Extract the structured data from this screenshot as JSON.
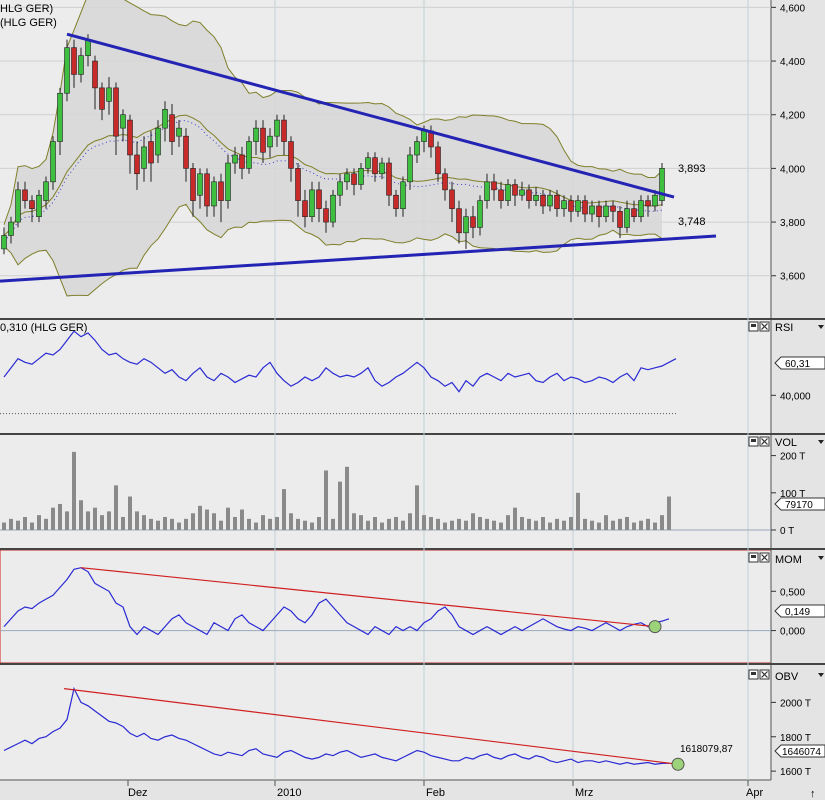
{
  "colors": {
    "panel_bg": "#ececec",
    "grid": "#c8c8c8",
    "band_fill": "#d7d7d7",
    "band_line": "#7f7f2a",
    "trend_blue": "#2424b4",
    "series_blue": "#2a2ad4",
    "up_candle": "#3fbf3f",
    "down_candle": "#c82a2a",
    "volume_bar": "#8a8a8a",
    "red_line": "#d02020",
    "marker_green": "#9cd27a"
  },
  "price_panel": {
    "title_line1": "HLG GER)",
    "title_line2": "(HLG GER)",
    "axis_ticks": [
      "4,600",
      "4,400",
      "4,200",
      "4,000",
      "3,800",
      "3,600"
    ],
    "label_upper": "3,893",
    "label_lower": "3,748"
  },
  "rsi_panel": {
    "title": "0,310 (HLG GER)",
    "name": "RSI",
    "current_value": "60,31",
    "tick": "40,000"
  },
  "vol_panel": {
    "name": "VOL",
    "ticks": [
      "200 T",
      "100 T",
      "0 T"
    ],
    "current_value": "79170"
  },
  "mom_panel": {
    "name": "MOM",
    "ticks": [
      "0,500",
      "0,000"
    ],
    "current_value": "0,149"
  },
  "obv_panel": {
    "name": "OBV",
    "ticks": [
      "2000 T",
      "1800 T",
      "1600 T"
    ],
    "current_value": "1646074",
    "end_label": "1618079,87"
  },
  "x_axis": {
    "labels": [
      "Dez",
      "2010",
      "Feb",
      "Mrz",
      "Apr"
    ],
    "arrow": "↑"
  },
  "chart_data": [
    {
      "type": "candlestick",
      "panel": "price",
      "ylim": [
        3.45,
        4.62
      ],
      "ticks": [
        3.6,
        3.8,
        4.0,
        4.2,
        4.4,
        4.6
      ],
      "candles": [
        [
          3.7,
          3.75,
          3.68,
          3.78
        ],
        [
          3.75,
          3.8,
          3.72,
          3.82
        ],
        [
          3.8,
          3.92,
          3.78,
          3.95
        ],
        [
          3.92,
          3.88,
          3.85,
          3.95
        ],
        [
          3.88,
          3.85,
          3.8,
          3.9
        ],
        [
          3.82,
          3.9,
          3.8,
          3.92
        ],
        [
          3.88,
          3.95,
          3.85,
          3.97
        ],
        [
          3.95,
          4.1,
          3.92,
          4.12
        ],
        [
          4.1,
          4.28,
          4.05,
          4.3
        ],
        [
          4.28,
          4.45,
          4.25,
          4.48
        ],
        [
          4.45,
          4.35,
          4.3,
          4.48
        ],
        [
          4.35,
          4.42,
          4.32,
          4.45
        ],
        [
          4.42,
          4.48,
          4.38,
          4.5
        ],
        [
          4.4,
          4.3,
          4.22,
          4.42
        ],
        [
          4.3,
          4.22,
          4.18,
          4.32
        ],
        [
          4.25,
          4.3,
          4.2,
          4.34
        ],
        [
          4.3,
          4.12,
          4.05,
          4.32
        ],
        [
          4.15,
          4.2,
          4.1,
          4.22
        ],
        [
          4.18,
          4.05,
          3.98,
          4.2
        ],
        [
          4.05,
          3.98,
          3.92,
          4.1
        ],
        [
          4.0,
          4.08,
          3.95,
          4.12
        ],
        [
          4.1,
          4.02,
          3.95,
          4.14
        ],
        [
          4.05,
          4.15,
          4.02,
          4.18
        ],
        [
          4.15,
          4.22,
          4.1,
          4.25
        ],
        [
          4.2,
          4.1,
          4.05,
          4.24
        ],
        [
          4.12,
          4.15,
          4.08,
          4.18
        ],
        [
          4.12,
          4.0,
          3.95,
          4.15
        ],
        [
          4.0,
          3.88,
          3.82,
          4.02
        ],
        [
          3.9,
          3.98,
          3.85,
          4.0
        ],
        [
          3.98,
          3.86,
          3.82,
          4.0
        ],
        [
          3.86,
          3.95,
          3.82,
          3.97
        ],
        [
          3.95,
          3.88,
          3.8,
          3.98
        ],
        [
          3.88,
          4.02,
          3.85,
          4.05
        ],
        [
          4.02,
          4.05,
          3.98,
          4.08
        ],
        [
          4.05,
          4.0,
          3.96,
          4.08
        ],
        [
          4.0,
          4.1,
          3.98,
          4.12
        ],
        [
          4.1,
          4.15,
          4.05,
          4.18
        ],
        [
          4.15,
          4.06,
          4.02,
          4.18
        ],
        [
          4.08,
          4.12,
          4.04,
          4.15
        ],
        [
          4.12,
          4.18,
          4.08,
          4.2
        ],
        [
          4.18,
          4.1,
          4.05,
          4.2
        ],
        [
          4.1,
          4.0,
          3.95,
          4.12
        ],
        [
          4.0,
          3.88,
          3.82,
          4.02
        ],
        [
          3.88,
          3.82,
          3.78,
          3.92
        ],
        [
          3.82,
          3.92,
          3.8,
          3.95
        ],
        [
          3.92,
          3.85,
          3.8,
          3.95
        ],
        [
          3.85,
          3.8,
          3.76,
          3.88
        ],
        [
          3.8,
          3.9,
          3.78,
          3.92
        ],
        [
          3.9,
          3.95,
          3.86,
          3.98
        ],
        [
          3.95,
          3.98,
          3.92,
          4.0
        ],
        [
          3.98,
          3.94,
          3.9,
          4.0
        ],
        [
          3.94,
          4.0,
          3.92,
          4.02
        ],
        [
          4.0,
          4.04,
          3.98,
          4.06
        ],
        [
          4.04,
          3.98,
          3.95,
          4.06
        ],
        [
          3.98,
          4.02,
          3.96,
          4.04
        ],
        [
          4.02,
          3.9,
          3.86,
          4.04
        ],
        [
          3.9,
          3.85,
          3.82,
          3.92
        ],
        [
          3.85,
          3.95,
          3.82,
          3.97
        ],
        [
          3.95,
          4.05,
          3.92,
          4.08
        ],
        [
          4.05,
          4.1,
          4.02,
          4.12
        ],
        [
          4.1,
          4.14,
          4.06,
          4.16
        ],
        [
          4.14,
          4.08,
          4.04,
          4.16
        ],
        [
          4.08,
          3.98,
          3.95,
          4.1
        ],
        [
          3.98,
          3.92,
          3.88,
          4.0
        ],
        [
          3.92,
          3.85,
          3.8,
          3.95
        ],
        [
          3.85,
          3.76,
          3.72,
          3.88
        ],
        [
          3.76,
          3.82,
          3.7,
          3.85
        ],
        [
          3.82,
          3.78,
          3.74,
          3.86
        ],
        [
          3.78,
          3.88,
          3.75,
          3.9
        ],
        [
          3.88,
          3.95,
          3.85,
          3.98
        ],
        [
          3.95,
          3.92,
          3.88,
          3.98
        ],
        [
          3.92,
          3.88,
          3.85,
          3.95
        ],
        [
          3.88,
          3.94,
          3.86,
          3.96
        ],
        [
          3.94,
          3.9,
          3.86,
          3.96
        ],
        [
          3.9,
          3.92,
          3.88,
          3.95
        ],
        [
          3.92,
          3.88,
          3.85,
          3.94
        ],
        [
          3.88,
          3.9,
          3.86,
          3.93
        ],
        [
          3.9,
          3.86,
          3.83,
          3.92
        ],
        [
          3.86,
          3.9,
          3.84,
          3.92
        ],
        [
          3.9,
          3.85,
          3.82,
          3.92
        ],
        [
          3.85,
          3.88,
          3.82,
          3.9
        ],
        [
          3.88,
          3.84,
          3.8,
          3.9
        ],
        [
          3.84,
          3.88,
          3.82,
          3.9
        ],
        [
          3.88,
          3.83,
          3.8,
          3.9
        ],
        [
          3.83,
          3.86,
          3.8,
          3.88
        ],
        [
          3.86,
          3.82,
          3.78,
          3.88
        ],
        [
          3.82,
          3.86,
          3.8,
          3.88
        ],
        [
          3.86,
          3.84,
          3.8,
          3.88
        ],
        [
          3.84,
          3.78,
          3.74,
          3.86
        ],
        [
          3.78,
          3.85,
          3.76,
          3.88
        ],
        [
          3.85,
          3.82,
          3.8,
          3.88
        ],
        [
          3.82,
          3.88,
          3.8,
          3.9
        ],
        [
          3.88,
          3.86,
          3.82,
          3.9
        ],
        [
          3.86,
          3.9,
          3.84,
          3.92
        ],
        [
          3.88,
          4.0,
          3.86,
          4.02
        ]
      ],
      "trendline_upper": {
        "from": [
          0,
          4.5
        ],
        "to": [
          95,
          3.893
        ]
      },
      "trendline_lower": {
        "from": [
          -12,
          3.58
        ],
        "to": [
          100,
          3.748
        ]
      }
    },
    {
      "type": "line",
      "panel": "rsi",
      "name": "RSI",
      "ylim": [
        20,
        80
      ],
      "values": [
        50,
        55,
        60,
        58,
        57,
        60,
        63,
        62,
        65,
        70,
        75,
        72,
        74,
        70,
        65,
        62,
        63,
        60,
        58,
        57,
        60,
        58,
        55,
        52,
        54,
        50,
        48,
        52,
        55,
        50,
        48,
        52,
        50,
        47,
        49,
        51,
        50,
        55,
        58,
        52,
        48,
        45,
        47,
        50,
        48,
        50,
        55,
        52,
        50,
        51,
        50,
        52,
        55,
        48,
        45,
        47,
        50,
        52,
        55,
        58,
        55,
        50,
        48,
        45,
        47,
        42,
        48,
        45,
        50,
        52,
        50,
        48,
        52,
        50,
        51,
        52,
        48,
        47,
        50,
        52,
        48,
        50,
        49,
        47,
        48,
        50,
        49,
        47,
        50,
        52,
        48,
        55,
        54,
        55,
        56,
        58,
        60
      ]
    },
    {
      "type": "bar",
      "panel": "volume",
      "name": "VOL",
      "ylim": [
        0,
        250
      ],
      "values": [
        20,
        30,
        25,
        35,
        20,
        40,
        30,
        60,
        70,
        50,
        210,
        80,
        50,
        60,
        40,
        50,
        120,
        35,
        90,
        50,
        40,
        30,
        25,
        35,
        30,
        20,
        30,
        45,
        65,
        55,
        45,
        25,
        60,
        35,
        55,
        30,
        20,
        40,
        30,
        35,
        110,
        45,
        30,
        25,
        20,
        35,
        160,
        30,
        130,
        170,
        45,
        40,
        25,
        35,
        20,
        30,
        35,
        25,
        45,
        120,
        40,
        35,
        30,
        20,
        25,
        30,
        25,
        45,
        35,
        30,
        25,
        20,
        40,
        60,
        35,
        30,
        25,
        35,
        20,
        30,
        25,
        35,
        100,
        30,
        25,
        20,
        40,
        25,
        30,
        35,
        20,
        25,
        30,
        20,
        40,
        90
      ]
    },
    {
      "type": "line",
      "panel": "momentum",
      "name": "MOM",
      "ylim": [
        -0.4,
        1.0
      ],
      "values": [
        0.05,
        0.15,
        0.25,
        0.3,
        0.28,
        0.35,
        0.4,
        0.45,
        0.55,
        0.65,
        0.78,
        0.8,
        0.75,
        0.6,
        0.55,
        0.5,
        0.35,
        0.3,
        0.05,
        -0.05,
        0.05,
        0.0,
        -0.05,
        0.05,
        0.15,
        0.2,
        0.1,
        0.05,
        0.0,
        -0.05,
        0.1,
        0.05,
        0.0,
        0.15,
        0.2,
        0.1,
        0.05,
        0.0,
        0.1,
        0.2,
        0.3,
        0.25,
        0.15,
        0.1,
        0.2,
        0.35,
        0.4,
        0.3,
        0.2,
        0.1,
        0.05,
        0.0,
        -0.05,
        0.05,
        0.0,
        -0.05,
        0.05,
        0.0,
        0.05,
        0.0,
        0.1,
        0.15,
        0.25,
        0.3,
        0.2,
        0.05,
        0.0,
        -0.05,
        0.0,
        0.05,
        0.0,
        -0.05,
        0.0,
        0.05,
        0.0,
        0.05,
        0.1,
        0.15,
        0.1,
        0.05,
        0.02,
        0.0,
        0.05,
        0.03,
        0.0,
        0.05,
        0.1,
        0.05,
        0.0,
        0.05,
        0.08,
        0.1,
        0.05,
        0.1,
        0.12,
        0.149
      ]
    },
    {
      "type": "line",
      "panel": "obv",
      "name": "OBV",
      "ylim": [
        1560,
        2200
      ],
      "values": [
        1720,
        1740,
        1760,
        1780,
        1760,
        1790,
        1800,
        1830,
        1850,
        1900,
        2080,
        2000,
        1980,
        1950,
        1920,
        1890,
        1880,
        1860,
        1820,
        1800,
        1820,
        1790,
        1780,
        1800,
        1810,
        1790,
        1780,
        1760,
        1740,
        1720,
        1700,
        1690,
        1710,
        1700,
        1690,
        1720,
        1730,
        1700,
        1690,
        1680,
        1710,
        1720,
        1700,
        1680,
        1670,
        1680,
        1700,
        1690,
        1710,
        1720,
        1700,
        1680,
        1690,
        1700,
        1680,
        1670,
        1660,
        1680,
        1700,
        1720,
        1710,
        1690,
        1680,
        1670,
        1660,
        1660,
        1680,
        1670,
        1690,
        1700,
        1680,
        1670,
        1690,
        1700,
        1680,
        1670,
        1690,
        1680,
        1660,
        1650,
        1660,
        1670,
        1650,
        1660,
        1660,
        1650,
        1660,
        1650,
        1640,
        1650,
        1640,
        1645,
        1650,
        1640,
        1645,
        1646
      ]
    }
  ]
}
